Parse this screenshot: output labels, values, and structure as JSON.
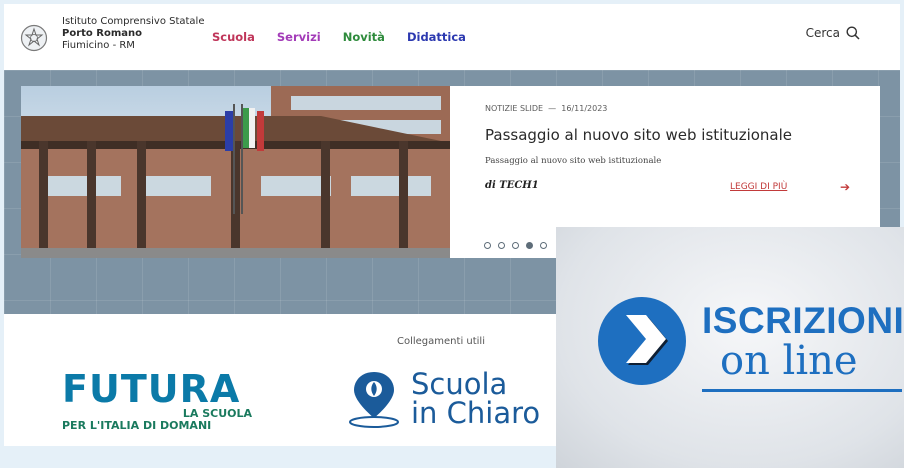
{
  "header": {
    "school_line1": "Istituto Comprensivo Statale",
    "school_line2": "Porto Romano",
    "school_line3": "Fiumicino - RM",
    "nav": [
      {
        "label": "Scuola",
        "color": "#c0365a"
      },
      {
        "label": "Servizi",
        "color": "#a33bb8"
      },
      {
        "label": "Novità",
        "color": "#2e8b3c"
      },
      {
        "label": "Didattica",
        "color": "#2c39b0"
      }
    ],
    "search_label": "Cerca"
  },
  "slide": {
    "category": "NOTIZIE SLIDE",
    "separator": "—",
    "date": "16/11/2023",
    "title": "Passaggio al nuovo sito web istituzionale",
    "subtitle": "Passaggio al nuovo sito web istituzionale",
    "author": "di TECH1",
    "read_more": "LEGGI DI PIÙ",
    "dots_total": 5,
    "active_dot": 4
  },
  "links": {
    "title": "Collegamenti utili",
    "futura_big": "FUTURA",
    "futura_line1": "LA SCUOLA",
    "futura_line2": "PER L'ITALIA DI DOMANI",
    "chiaro_line1": "Scuola",
    "chiaro_line2": "in Chiaro"
  },
  "popup": {
    "title": "ISCRIZIONI",
    "subtitle": "on line",
    "brand_color": "#1e6fc0"
  }
}
